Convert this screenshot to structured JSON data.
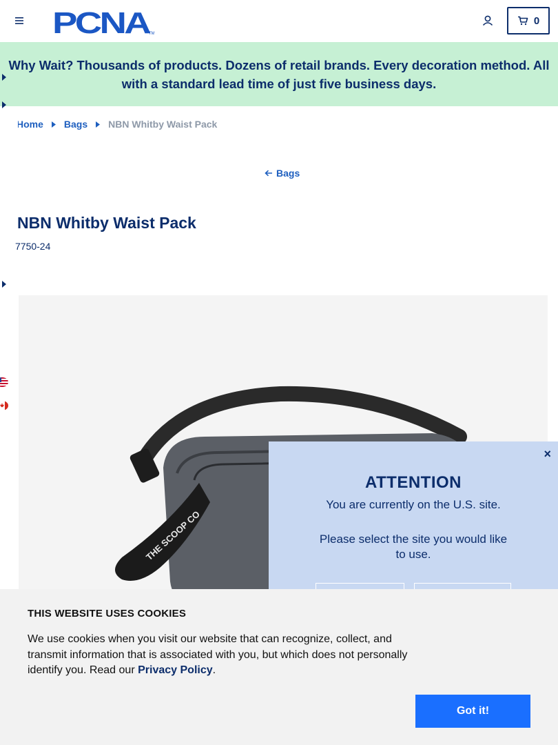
{
  "header": {
    "logo_text": "PCNA",
    "cart_count": "0"
  },
  "promo": {
    "text": "Why Wait? Thousands of products. Dozens of retail brands. Every decoration method. All with a standard lead time of just five business days."
  },
  "breadcrumb": {
    "items": [
      "Home",
      "Bags"
    ],
    "current": "NBN Whitby Waist Pack"
  },
  "back_link": {
    "label": "Bags"
  },
  "product": {
    "title": "NBN Whitby Waist Pack",
    "sku": "7750-24",
    "image_strap_text": "THE SCOOP CO"
  },
  "flags": [
    "us-flag-icon",
    "canada-flag-icon"
  ],
  "modal": {
    "title": "ATTENTION",
    "line1": "You are currently on the U.S. site.",
    "line2": "Please select the site you would like to use.",
    "close": "×"
  },
  "cookie": {
    "title": "THIS WEBSITE USES COOKIES",
    "text": "We use cookies when you visit our website that can recognize, collect, and transmit information that is associated with you, but which does not personally identify you. Read our",
    "link": "Privacy Policy",
    "suffix": ".",
    "button": "Got it!"
  },
  "colors": {
    "navy": "#0c2d6b",
    "link_blue": "#1e5fbf",
    "promo_bg": "#c6f0d4",
    "modal_bg": "#c8d8f2",
    "cookie_button": "#1a6fff"
  }
}
